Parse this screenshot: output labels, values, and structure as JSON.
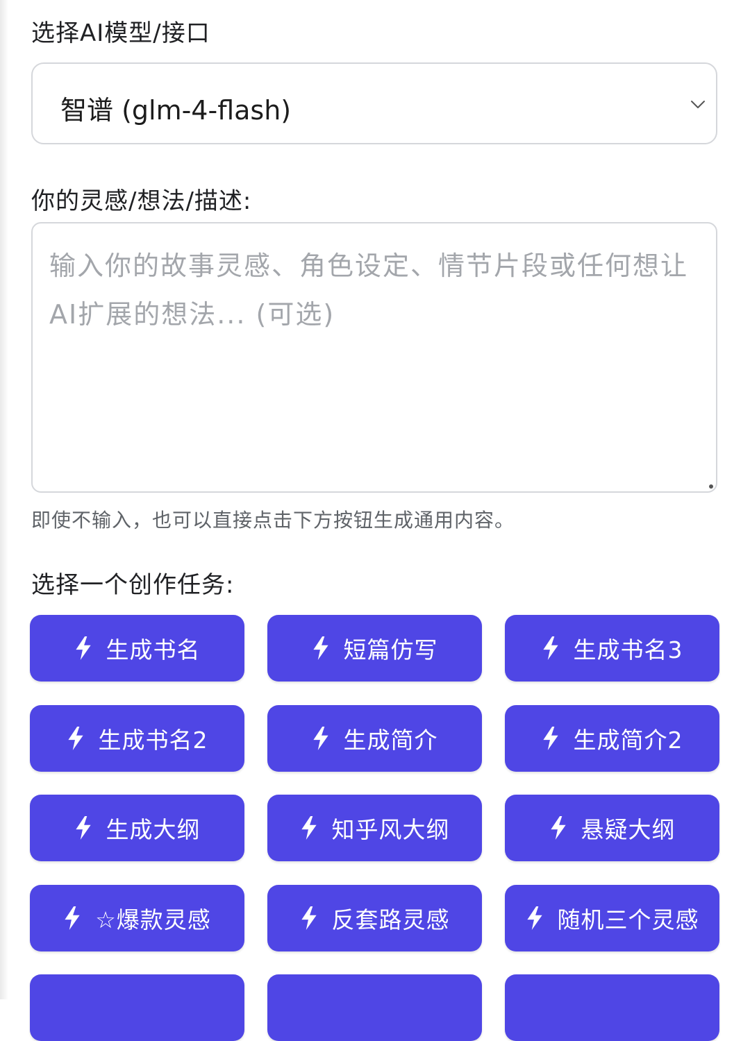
{
  "model_section": {
    "label": "选择AI模型/接口",
    "selected_value": "智谱 (glm-4-flash)"
  },
  "idea_section": {
    "label": "你的灵感/想法/描述:",
    "placeholder": "输入你的故事灵感、角色设定、情节片段或任何想让AI扩展的想法... (可选)",
    "value": "",
    "hint": "即使不输入，也可以直接点击下方按钮生成通用内容。"
  },
  "task_section": {
    "label": "选择一个创作任务:",
    "buttons": [
      {
        "label": "生成书名"
      },
      {
        "label": "短篇仿写"
      },
      {
        "label": "生成书名3"
      },
      {
        "label": "生成书名2"
      },
      {
        "label": "生成简介"
      },
      {
        "label": "生成简介2"
      },
      {
        "label": "生成大纲"
      },
      {
        "label": "知乎风大纲"
      },
      {
        "label": "悬疑大纲"
      },
      {
        "label": "☆爆款灵感"
      },
      {
        "label": "反套路灵感"
      },
      {
        "label": "随机三个灵感"
      }
    ]
  },
  "icons": {
    "dropdown": "chevron-down-icon",
    "button": "lightning-bolt-icon"
  },
  "colors": {
    "button_bg": "#4f46e5",
    "button_text": "#ffffff",
    "border": "#d5d7db",
    "placeholder": "#a3a6ab"
  }
}
